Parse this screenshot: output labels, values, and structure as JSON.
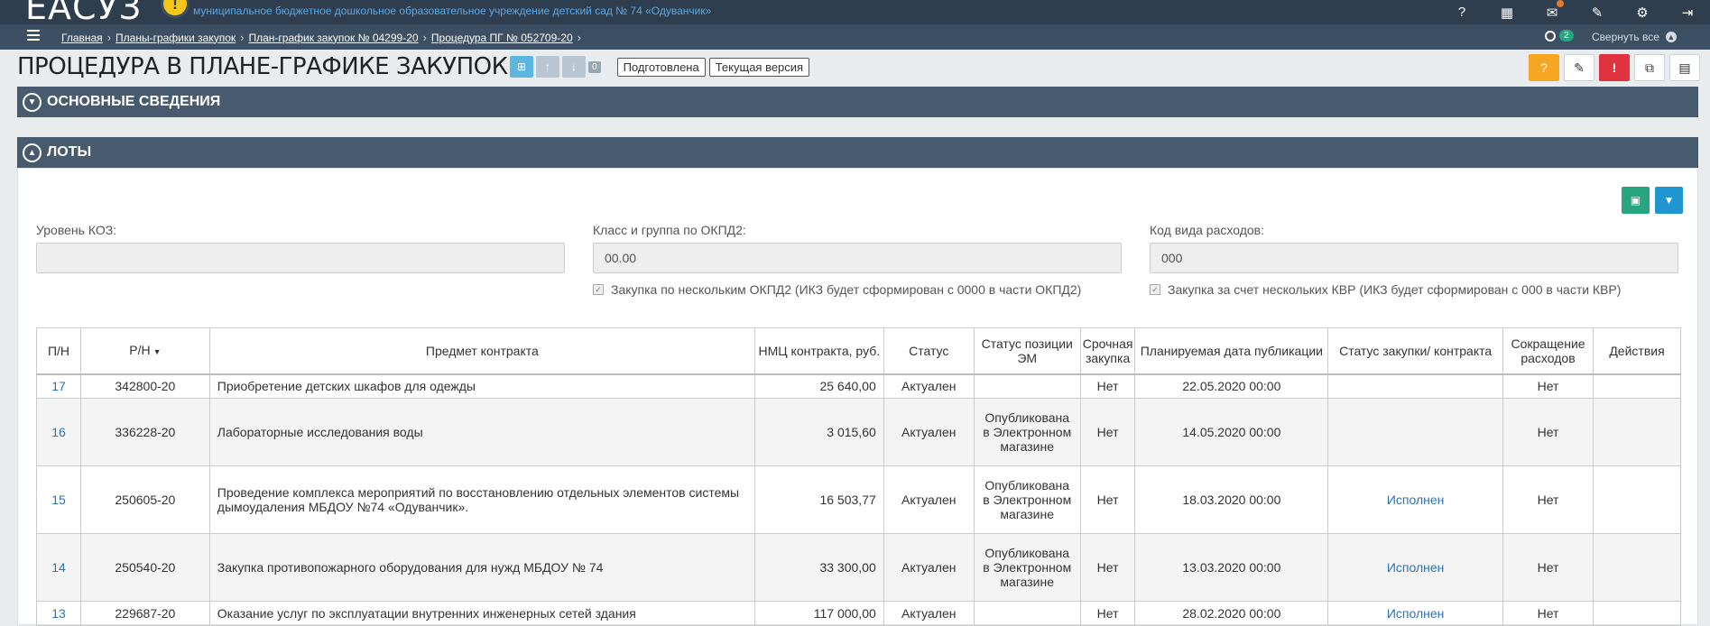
{
  "header": {
    "logo": "ЕАСУЗ",
    "org_name": "муниципальное бюджетное дошкольное образовательное учреждение детский сад № 74 «Одуванчик»",
    "icons": [
      "help-icon",
      "grid-icon",
      "mail-icon",
      "wrench-icon",
      "gear-icon",
      "exit-icon"
    ]
  },
  "breadcrumb": {
    "items": [
      "Главная",
      "Планы-графики закупок",
      "План-график закупок № 04299-20",
      "Процедура ПГ № 052709-20"
    ],
    "history_count": "2",
    "collapse_all": "Свернуть все"
  },
  "page": {
    "title": "ПРОЦЕДУРА В ПЛАНЕ-ГРАФИКЕ ЗАКУПОК",
    "nav_count": "0",
    "status_tag": "Подготовлена",
    "version_tag": "Текущая версия"
  },
  "sections": {
    "main_info": "ОСНОВНЫЕ СВЕДЕНИЯ",
    "lots": "ЛОТЫ"
  },
  "filters": {
    "koz_label": "Уровень КОЗ:",
    "koz_value": "",
    "okpd_label": "Класс и группа по ОКПД2:",
    "okpd_value": "00.00",
    "kvr_label": "Код вида расходов:",
    "kvr_value": "000",
    "okpd_check": "Закупка по нескольким ОКПД2 (ИКЗ будет сформирован с 0000 в части ОКПД2)",
    "kvr_check": "Закупка за счет нескольких КВР (ИКЗ будет сформирован с 000 в части КВР)"
  },
  "table": {
    "headers": {
      "pn": "П/Н",
      "rn": "Р/Н",
      "subject": "Предмет контракта",
      "nmc": "НМЦ контракта, руб.",
      "status": "Статус",
      "em_status": "Статус позиции ЭМ",
      "urgent": "Срочная закупка",
      "pub_date": "Планируемая дата публикации",
      "purchase_status": "Статус закупки/ контракта",
      "reduction": "Сокращение расходов",
      "actions": "Действия"
    },
    "rows": [
      {
        "pn": "17",
        "rn": "342800-20",
        "subject": "Приобретение детских шкафов для одежды",
        "nmc": "25 640,00",
        "status": "Актуален",
        "em_status": "",
        "urgent": "Нет",
        "pub_date": "22.05.2020 00:00",
        "purchase_status": "",
        "reduction": "Нет"
      },
      {
        "pn": "16",
        "rn": "336228-20",
        "subject": "Лабораторные исследования воды",
        "nmc": "3 015,60",
        "status": "Актуален",
        "em_status": "Опубликована в Электронном магазине",
        "urgent": "Нет",
        "pub_date": "14.05.2020 00:00",
        "purchase_status": "",
        "reduction": "Нет"
      },
      {
        "pn": "15",
        "rn": "250605-20",
        "subject": "Проведение комплекса мероприятий по восстановлению отдельных элементов системы дымоудаления МБДОУ №74 «Одуванчик».",
        "nmc": "16 503,77",
        "status": "Актуален",
        "em_status": "Опубликована в Электронном магазине",
        "urgent": "Нет",
        "pub_date": "18.03.2020 00:00",
        "purchase_status": "Исполнен",
        "reduction": "Нет"
      },
      {
        "pn": "14",
        "rn": "250540-20",
        "subject": "Закупка противопожарного оборудования для нужд МБДОУ № 74",
        "nmc": "33 300,00",
        "status": "Актуален",
        "em_status": "Опубликована в Электронном магазине",
        "urgent": "Нет",
        "pub_date": "13.03.2020 00:00",
        "purchase_status": "Исполнен",
        "reduction": "Нет"
      },
      {
        "pn": "13",
        "rn": "229687-20",
        "subject": "Оказание услуг по эксплуатации внутренних инженерных сетей здания",
        "nmc": "117 000,00",
        "status": "Актуален",
        "em_status": "",
        "urgent": "Нет",
        "pub_date": "28.02.2020 00:00",
        "purchase_status": "Исполнен",
        "reduction": "Нет"
      }
    ]
  }
}
